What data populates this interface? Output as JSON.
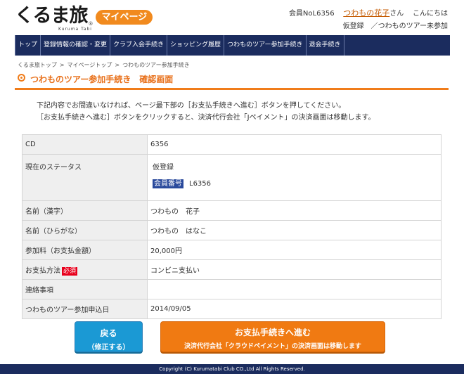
{
  "logo": {
    "text": "くるま旅",
    "sub": "Kuruma Tabi",
    "reg": "®",
    "badge": "マイページ"
  },
  "user": {
    "member_label": "会員NoL6356",
    "name": "つわもの花子",
    "honorific": "さん",
    "greeting": "こんにちは",
    "status1": "仮登録",
    "status2": "／つわものツアー未参加"
  },
  "nav": [
    {
      "label": "トップ"
    },
    {
      "label": "登録情報の確認・変更"
    },
    {
      "label": "クラブ入会手続き"
    },
    {
      "label": "ショッピング履歴"
    },
    {
      "label": "つわものツアー参加手続き"
    },
    {
      "label": "退会手続き"
    }
  ],
  "breadcrumb": {
    "items": [
      "くるま旅トップ",
      "マイページトップ",
      "つわものツアー参加手続き"
    ],
    "separator": ">"
  },
  "page_title": "つわものツアー参加手続き　確認画面",
  "intro": {
    "line1": "下記内容でお間違いなければ、ページ最下部の［お支払手続きへ進む］ボタンを押してください。",
    "line2": "［お支払手続きへ進む］ボタンをクリックすると、決済代行会社「Jペイメント」の決済画面は移動します。"
  },
  "table": {
    "cd": {
      "label": "CD",
      "value": "6356"
    },
    "status": {
      "label": "現在のステータス",
      "value": "仮登録",
      "member_badge": "会員番号",
      "member_no": "L6356"
    },
    "name_kanji": {
      "label": "名前（漢字）",
      "value": "つわもの　花子"
    },
    "name_kana": {
      "label": "名前（ひらがな）",
      "value": "つわもの　はなこ"
    },
    "fee": {
      "label": "参加料（お支払金額）",
      "value": "20,000円"
    },
    "payment": {
      "label": "お支払方法",
      "required": "必須",
      "value": "コンビニ支払い"
    },
    "notes": {
      "label": "連絡事項",
      "value": ""
    },
    "date": {
      "label": "つわものツアー参加申込日",
      "value": "2014/09/05"
    }
  },
  "buttons": {
    "back_line1": "戻る",
    "back_line2": "（修正する）",
    "pay_line1": "お支払手続きへ進む",
    "pay_line2": "決済代行会社「クラウドペイメント」の決済画面は移動します"
  },
  "footer": "Copyright (C) Kurumatabi Club CO.,Ltd All Rights Reserved.",
  "colors": {
    "nav": "#1b2c5e",
    "accent": "#f07c1a",
    "back_button": "#1b99d4",
    "required": "#e8001c"
  }
}
